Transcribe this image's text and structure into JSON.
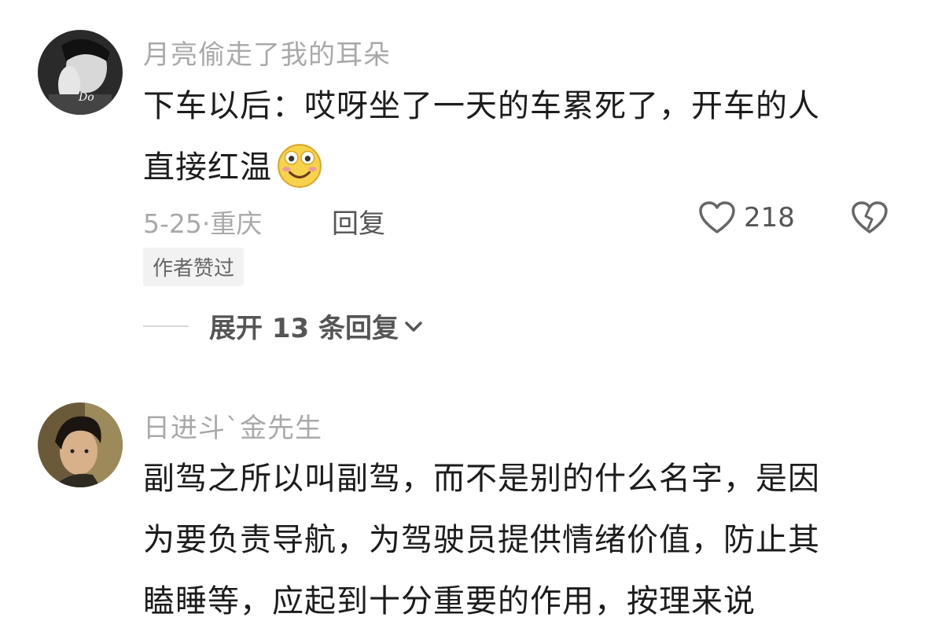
{
  "comments": [
    {
      "username": "月亮偷走了我的耳朵",
      "lines": [
        "下车以后：哎呀坐了一天的车累死了，开车的人",
        "直接红温"
      ],
      "emoji": "smiley-emoji",
      "date_location": "5-25·重庆",
      "reply_label": "回复",
      "like_count": "218",
      "author_liked": "作者赞过",
      "expand_label": "展开 13 条回复"
    },
    {
      "username": "日进斗`金先生",
      "lines": [
        "副驾之所以叫副驾，而不是别的什么名字，是因",
        "为要负责导航，为驾驶员提供情绪价值，防止其",
        "瞌睡等，应起到十分重要的作用，按理来说"
      ]
    }
  ],
  "icons": {
    "like": "heart-outline-icon",
    "dislike": "broken-heart-icon",
    "expand": "chevron-down-icon"
  },
  "colors": {
    "text_primary": "#1c1c1c",
    "text_secondary": "#a9a9a9",
    "text_action": "#555555",
    "tag_bg": "#f2f2f2"
  }
}
